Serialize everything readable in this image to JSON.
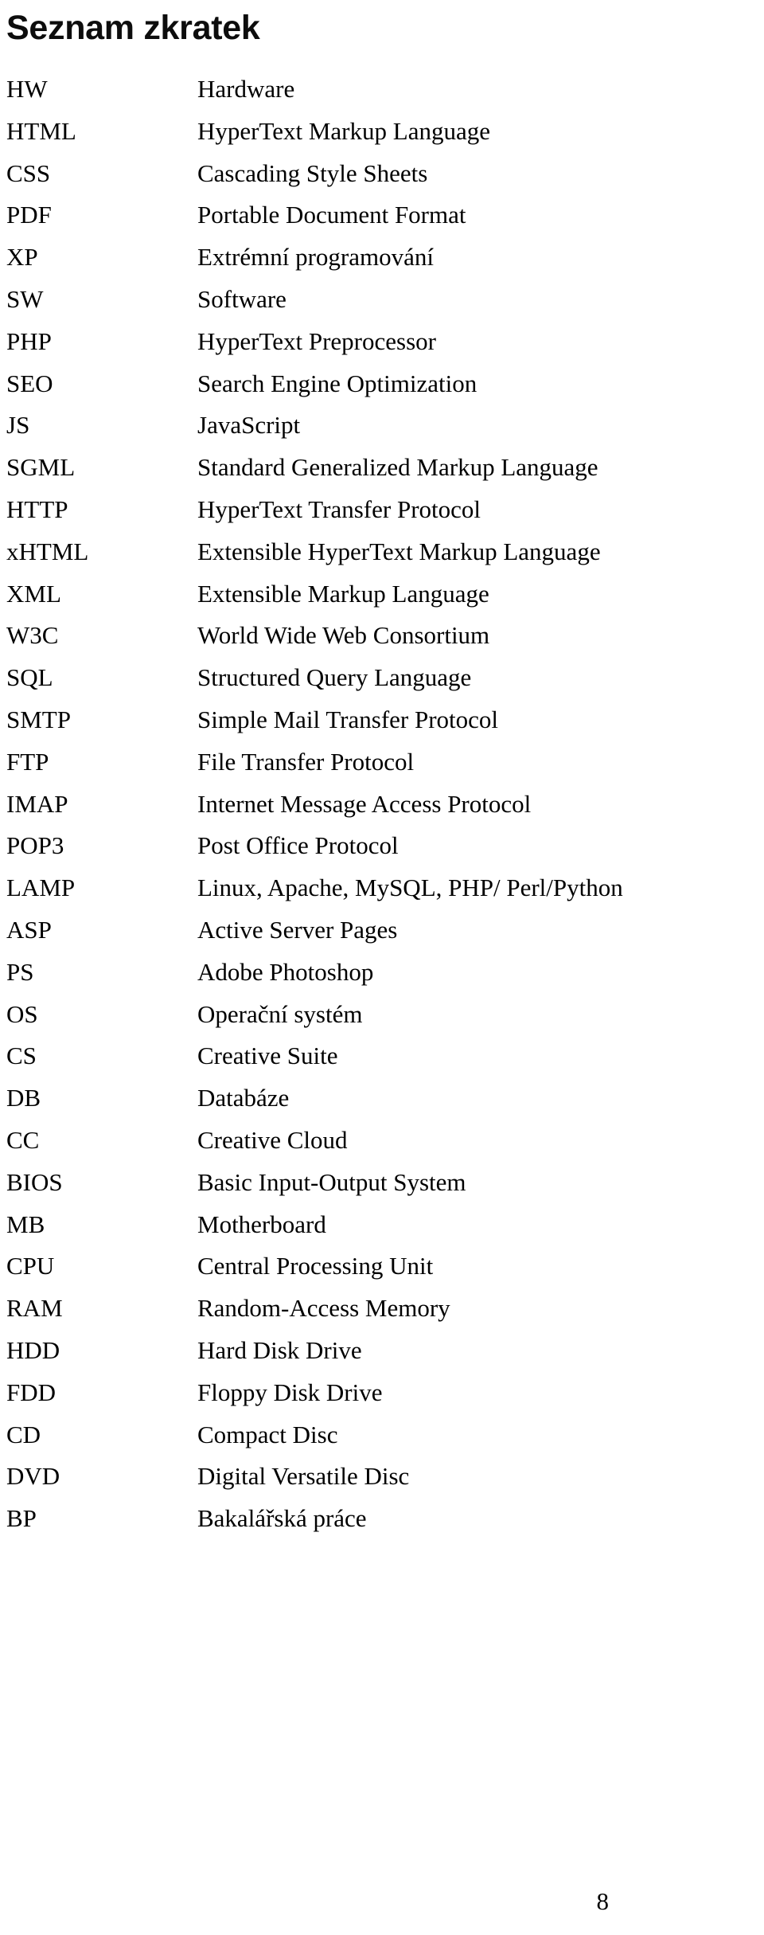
{
  "document": {
    "title": "Seznam zkratek",
    "language": "cs"
  },
  "abbreviations": [
    {
      "term": "HW",
      "definition": "Hardware"
    },
    {
      "term": "HTML",
      "definition": "HyperText Markup Language"
    },
    {
      "term": "CSS",
      "definition": "Cascading Style Sheets"
    },
    {
      "term": "PDF",
      "definition": "Portable Document Format"
    },
    {
      "term": "XP",
      "definition": "Extrémní programování"
    },
    {
      "term": "SW",
      "definition": "Software"
    },
    {
      "term": "PHP",
      "definition": "HyperText Preprocessor"
    },
    {
      "term": "SEO",
      "definition": "Search Engine Optimization"
    },
    {
      "term": "JS",
      "definition": "JavaScript"
    },
    {
      "term": "SGML",
      "definition": "Standard Generalized Markup Language"
    },
    {
      "term": "HTTP",
      "definition": "HyperText Transfer Protocol"
    },
    {
      "term": "xHTML",
      "definition": "Extensible HyperText Markup Language"
    },
    {
      "term": "XML",
      "definition": "Extensible Markup Language"
    },
    {
      "term": "W3C",
      "definition": "World Wide Web Consortium"
    },
    {
      "term": "SQL",
      "definition": "Structured Query Language"
    },
    {
      "term": "SMTP",
      "definition": "Simple Mail Transfer Protocol"
    },
    {
      "term": "FTP",
      "definition": "File Transfer Protocol"
    },
    {
      "term": "IMAP",
      "definition": "Internet Message Access Protocol"
    },
    {
      "term": "POP3",
      "definition": "Post Office Protocol"
    },
    {
      "term": "LAMP",
      "definition": "Linux, Apache, MySQL, PHP/ Perl/Python"
    },
    {
      "term": "ASP",
      "definition": "Active Server Pages"
    },
    {
      "term": "PS",
      "definition": "Adobe Photoshop"
    },
    {
      "term": "OS",
      "definition": "Operační systém"
    },
    {
      "term": "CS",
      "definition": "Creative Suite"
    },
    {
      "term": "DB",
      "definition": "Databáze"
    },
    {
      "term": "CC",
      "definition": "Creative Cloud"
    },
    {
      "term": "BIOS",
      "definition": "Basic Input-Output System"
    },
    {
      "term": "MB",
      "definition": "Motherboard"
    },
    {
      "term": "CPU",
      "definition": "Central Processing Unit"
    },
    {
      "term": "RAM",
      "definition": "Random-Access Memory"
    },
    {
      "term": "HDD",
      "definition": "Hard Disk Drive"
    },
    {
      "term": "FDD",
      "definition": "Floppy Disk Drive"
    },
    {
      "term": "CD",
      "definition": "Compact Disc"
    },
    {
      "term": "DVD",
      "definition": "Digital Versatile Disc"
    },
    {
      "term": "BP",
      "definition": "Bakalářská práce"
    }
  ],
  "footer": {
    "page_number": "8"
  },
  "colors": {
    "text": "#000000",
    "background": "#ffffff"
  }
}
